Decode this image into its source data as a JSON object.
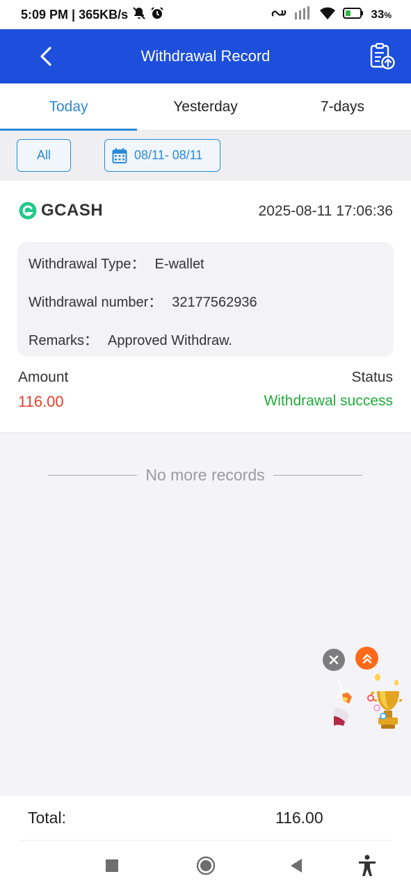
{
  "status_bar": {
    "time_speed": "5:09 PM | 365KB/s",
    "battery": "33",
    "battery_unit": "%",
    "icons": [
      "mute-bell-icon",
      "alarm-icon",
      "link-icon",
      "signal-icon",
      "wifi-icon",
      "battery-icon"
    ]
  },
  "header": {
    "title": "Withdrawal Record",
    "back_icon": "chevron-left-icon",
    "action_icon": "clipboard-upload-icon"
  },
  "tabs": [
    {
      "label": "Today",
      "active": true
    },
    {
      "label": "Yesterday",
      "active": false
    },
    {
      "label": "7-days",
      "active": false
    }
  ],
  "filters": {
    "all_label": "All",
    "date_range": "08/11- 08/11",
    "date_icon": "calendar-icon"
  },
  "record": {
    "brand": "GCASH",
    "datetime": "2025-08-11 17:06:36",
    "type_label": "Withdrawal Type：",
    "type_value": "E-wallet",
    "number_label": "Withdrawal number：",
    "number_value": "32177562936",
    "remarks_label": "Remarks：",
    "remarks_value": "Approved Withdraw.",
    "amount_label": "Amount",
    "amount_value": "116.00",
    "status_label": "Status",
    "status_value": "Withdrawal success",
    "colors": {
      "amount": "#e2402d",
      "status": "#1fae3a"
    }
  },
  "list_end": "No more records",
  "total": {
    "label": "Total:",
    "value": "116.00"
  },
  "colors": {
    "header": "#1d4fdc",
    "accent": "#2a8ad8"
  },
  "nav": [
    "recents-square-icon",
    "home-circle-icon",
    "back-triangle-icon",
    "accessibility-icon"
  ]
}
